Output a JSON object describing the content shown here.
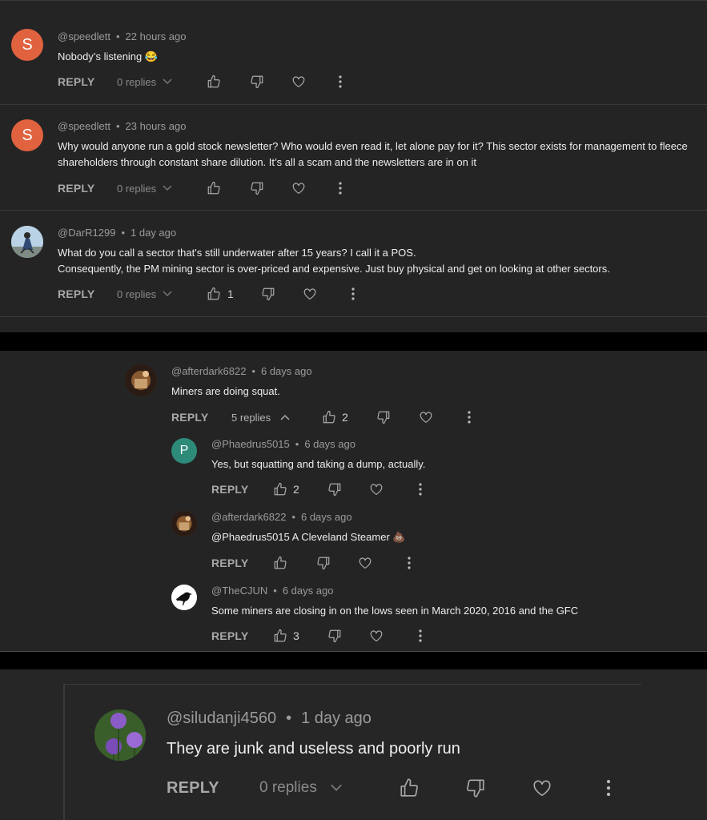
{
  "comments": [
    {
      "handle": "@speedlett",
      "age": "22 hours ago",
      "text1": "Nobody’s listening 😂",
      "reply": "REPLY",
      "replies": "0 replies",
      "likes": "",
      "initial": "S"
    },
    {
      "handle": "@speedlett",
      "age": "23 hours ago",
      "text1": "Why would anyone run a gold stock newsletter? Who would even read it, let alone pay for it? This sector exists for management to fleece",
      "text2": "shareholders through constant share dilution. It’s all a scam and the newsletters are in on it",
      "reply": "REPLY",
      "replies": "0 replies",
      "likes": "",
      "initial": "S"
    },
    {
      "handle": "@DarR1299",
      "age": "1 day ago",
      "text1": "What do you call a sector that's still underwater after 15 years? I call it a POS.",
      "text2": "Consequently, the PM mining sector is over-priced and expensive. Just buy physical and get on looking at other sectors.",
      "reply": "REPLY",
      "replies": "0 replies",
      "likes": "1"
    },
    {
      "handle": "@afterdark6822",
      "age": "6 days ago",
      "text1": "Miners are doing squat.",
      "reply": "REPLY",
      "replies": "5 replies",
      "likes": "2"
    },
    {
      "handle": "@Phaedrus5015",
      "age": "6 days ago",
      "text1": "Yes, but squatting and taking a dump, actually.",
      "reply": "REPLY",
      "likes": "2",
      "initial": "P"
    },
    {
      "handle": "@afterdark6822",
      "age": "6 days ago",
      "text1": " @Phaedrus5015  A Cleveland Steamer 💩",
      "reply": "REPLY",
      "likes": ""
    },
    {
      "handle": "@TheCJUN",
      "age": "6 days ago",
      "text1": "Some miners are closing in on the lows  seen in March 2020, 2016 and the GFC",
      "reply": "REPLY",
      "likes": "3"
    },
    {
      "handle": "@siludanji4560",
      "age": "1 day ago",
      "text1": "They are  junk and useless and poorly run",
      "reply": "REPLY",
      "replies": "0 replies",
      "likes": ""
    }
  ],
  "separator": "•",
  "icons": {
    "like": "thumbs-up-icon",
    "dislike": "thumbs-down-icon",
    "heart": "heart-icon",
    "more": "more-vertical-icon",
    "chevron": "chevron-icon"
  }
}
